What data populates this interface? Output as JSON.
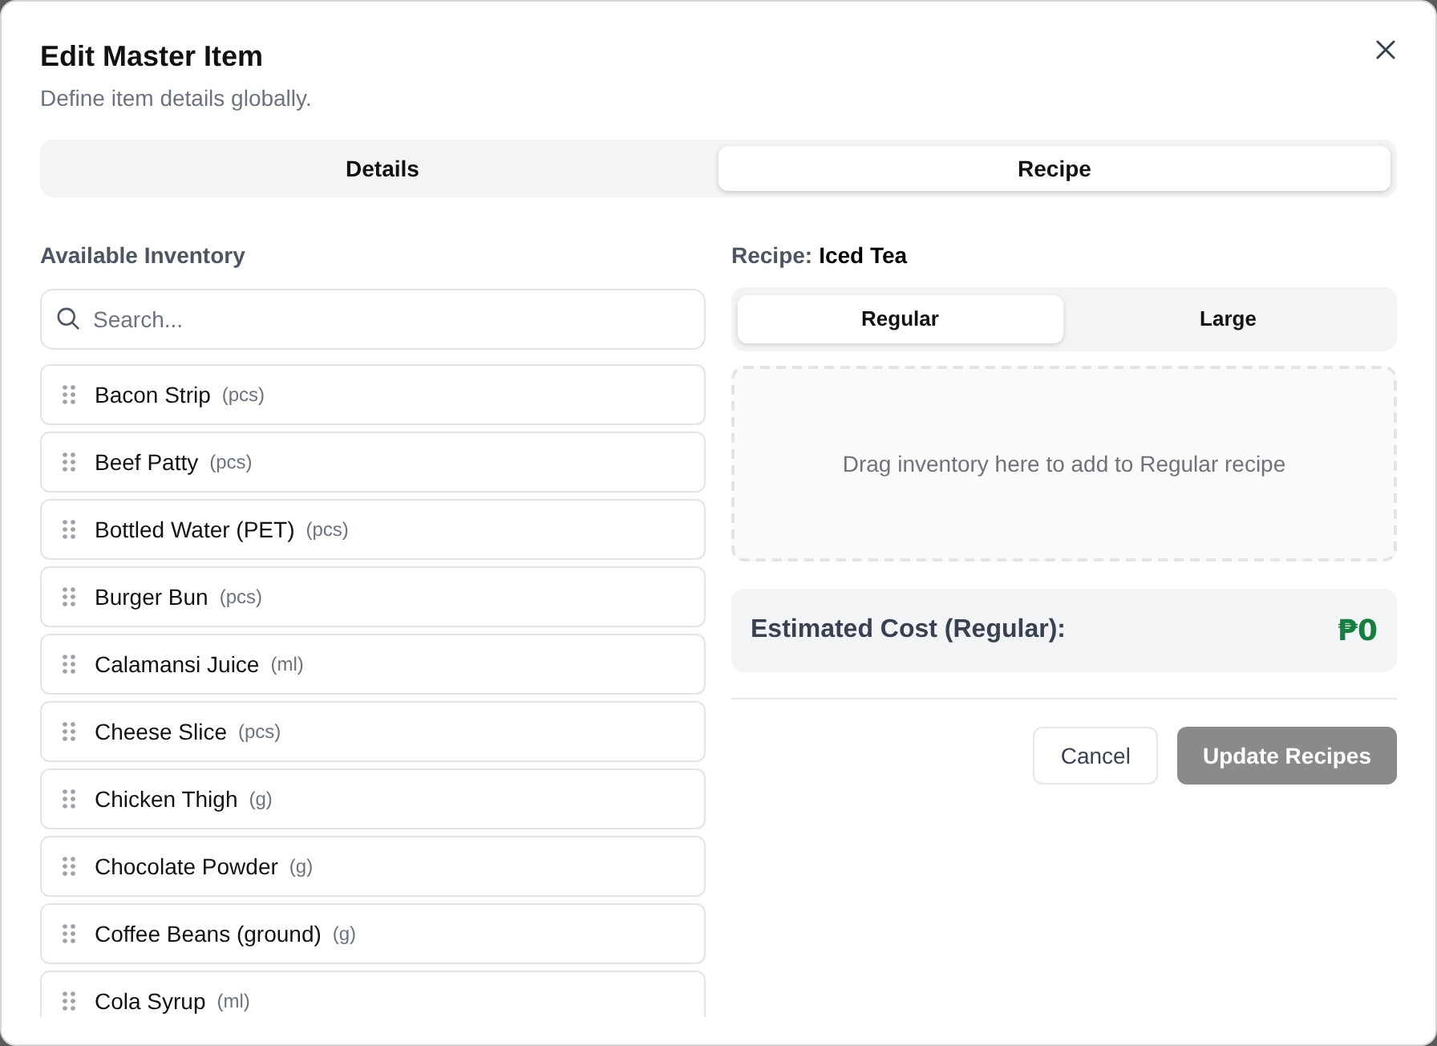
{
  "dialog": {
    "title": "Edit Master Item",
    "subtitle": "Define item details globally."
  },
  "tabs": [
    {
      "label": "Details",
      "selected": false
    },
    {
      "label": "Recipe",
      "selected": true
    }
  ],
  "inventory": {
    "heading": "Available Inventory",
    "search": {
      "placeholder": "Search..."
    },
    "items": [
      {
        "name": "Bacon Strip",
        "unit": "(pcs)"
      },
      {
        "name": "Beef Patty",
        "unit": "(pcs)"
      },
      {
        "name": "Bottled Water (PET)",
        "unit": "(pcs)"
      },
      {
        "name": "Burger Bun",
        "unit": "(pcs)"
      },
      {
        "name": "Calamansi Juice",
        "unit": "(ml)"
      },
      {
        "name": "Cheese Slice",
        "unit": "(pcs)"
      },
      {
        "name": "Chicken Thigh",
        "unit": "(g)"
      },
      {
        "name": "Chocolate Powder",
        "unit": "(g)"
      },
      {
        "name": "Coffee Beans (ground)",
        "unit": "(g)"
      },
      {
        "name": "Cola Syrup",
        "unit": "(ml)"
      }
    ]
  },
  "recipe": {
    "label": "Recipe:",
    "name": "Iced Tea",
    "size_tabs": [
      {
        "label": "Regular",
        "selected": true
      },
      {
        "label": "Large",
        "selected": false
      }
    ],
    "drop_zone": {
      "text": "Drag inventory here to add to Regular recipe"
    },
    "cost": {
      "label": "Estimated Cost (Regular):",
      "value": "₱0"
    }
  },
  "buttons": [
    {
      "label": "Cancel",
      "kind": "secondary",
      "disabled": false
    },
    {
      "label": "Update Recipes",
      "kind": "primary",
      "disabled": true
    }
  ]
}
